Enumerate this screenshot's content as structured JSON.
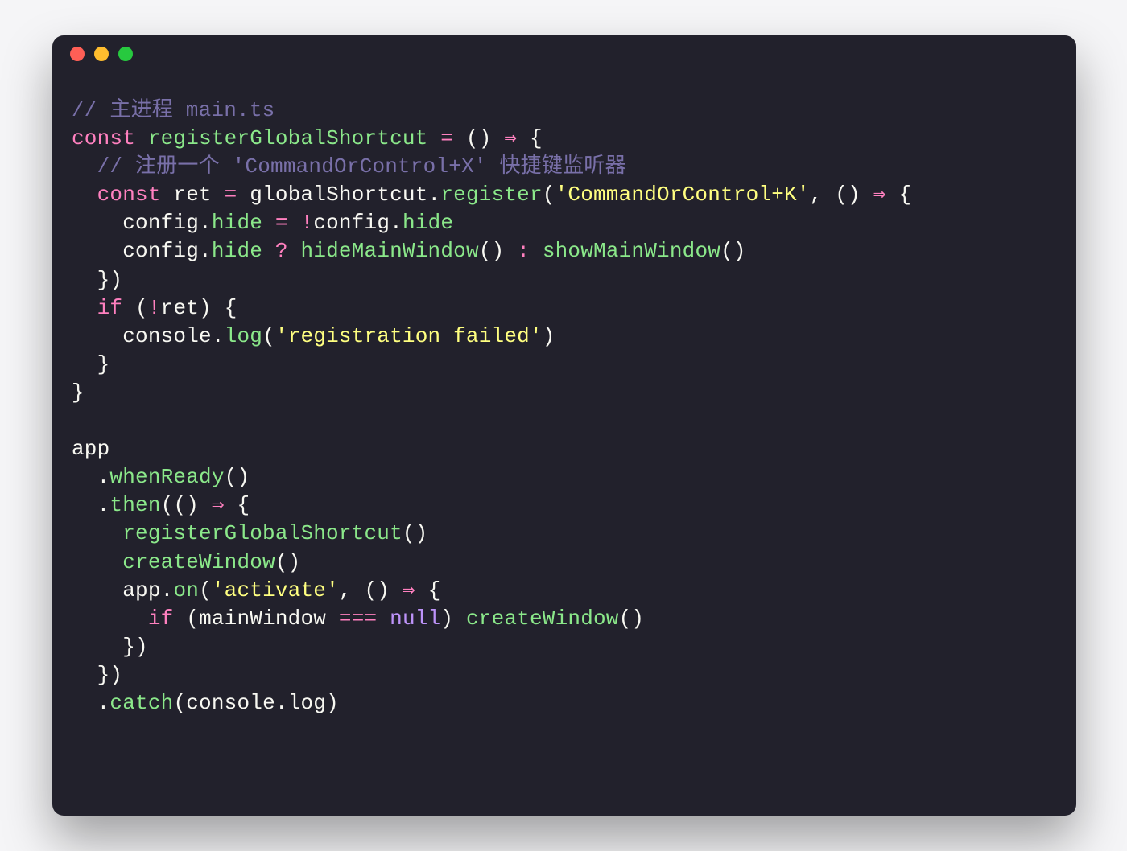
{
  "colors": {
    "background": "#22212c",
    "dot_red": "#ff5f56",
    "dot_yellow": "#ffbd2e",
    "dot_green": "#27c93f"
  },
  "comments": {
    "file_header": "// 主进程 main.ts",
    "shortcut": "// 注册一个 'CommandOrControl+X' 快捷键监听器"
  },
  "strings": {
    "shortcut_key": "'CommandOrControl+K'",
    "reg_failed": "'registration failed'",
    "activate": "'activate'"
  },
  "identifiers": {
    "const": "const",
    "if": "if",
    "null": "null",
    "registerGlobalShortcut": "registerGlobalShortcut",
    "globalShortcut": "globalShortcut",
    "register": "register",
    "config": "config",
    "hide": "hide",
    "hideMainWindow": "hideMainWindow",
    "showMainWindow": "showMainWindow",
    "ret": "ret",
    "console": "console",
    "log": "log",
    "app": "app",
    "whenReady": "whenReady",
    "then": "then",
    "createWindow": "createWindow",
    "on": "on",
    "mainWindow": "mainWindow",
    "catch": "catch"
  }
}
